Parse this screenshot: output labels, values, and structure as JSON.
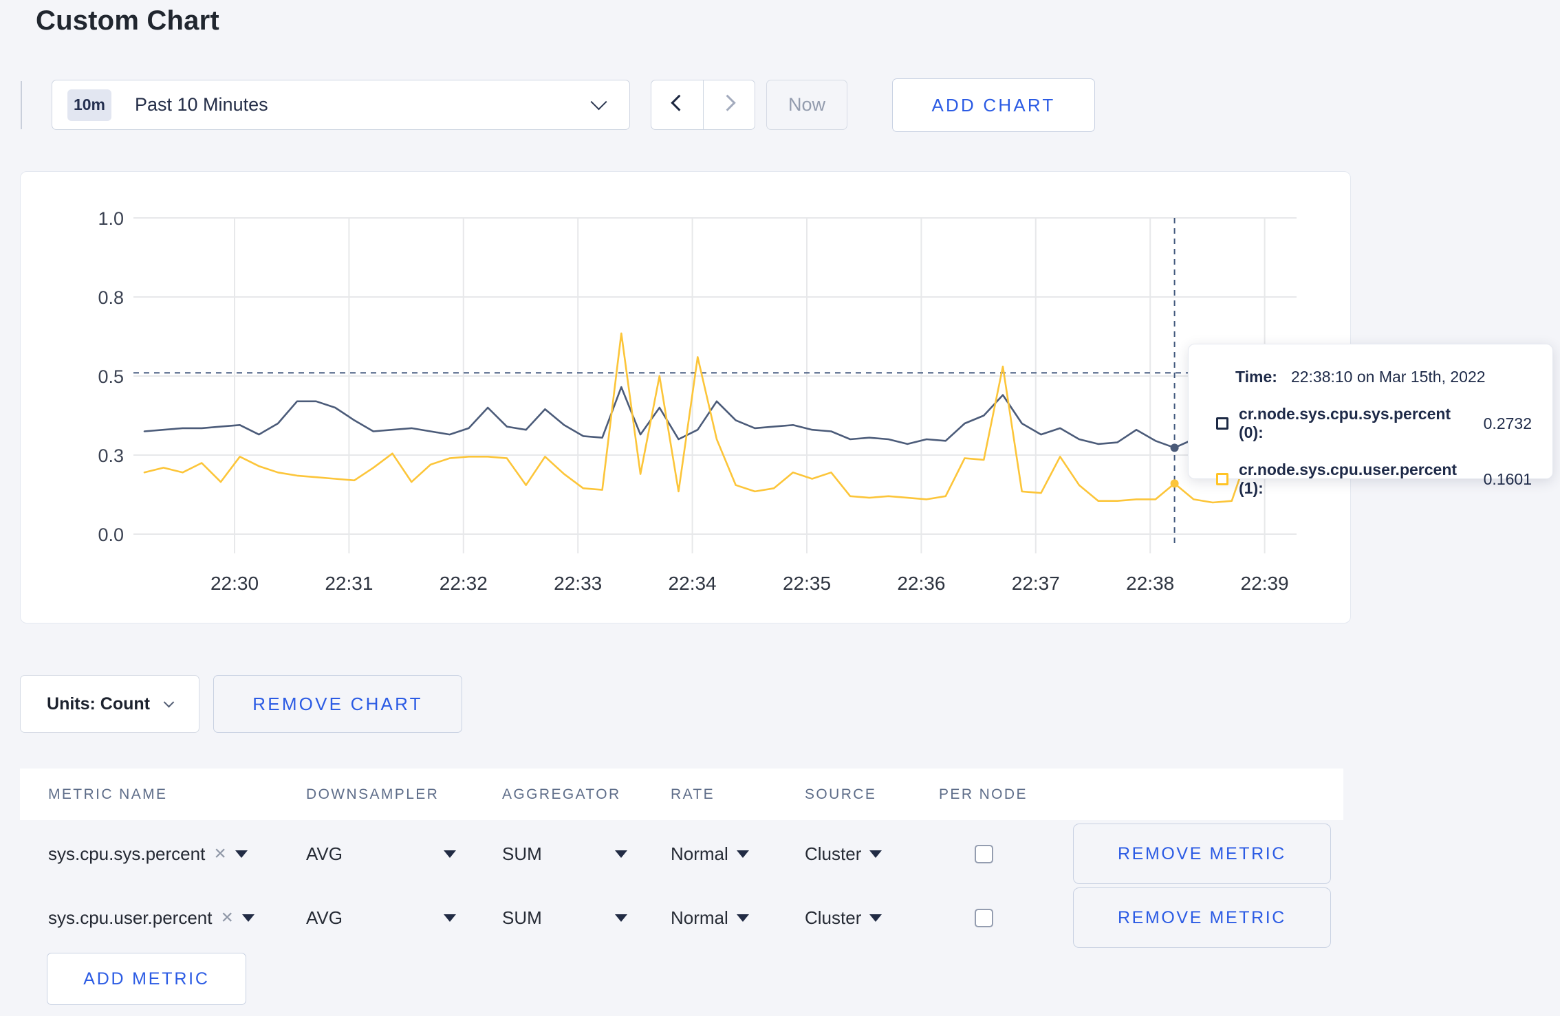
{
  "header": {
    "title": "Custom Chart"
  },
  "toolbar": {
    "time_badge": "10m",
    "time_label": "Past 10 Minutes",
    "now_label": "Now",
    "add_chart_label": "ADD CHART"
  },
  "units": {
    "label": "Units: Count",
    "remove_chart_label": "REMOVE CHART"
  },
  "colors": {
    "accent_blue": "#2b5be4",
    "series_sys": "#4b5b79",
    "series_user": "#fcc539",
    "crosshair": "#42587d",
    "grid": "#e7e8ea"
  },
  "tooltip": {
    "time_label": "Time:",
    "time_value": "22:38:10 on Mar 15th, 2022",
    "rows": [
      {
        "label": "cr.node.sys.cpu.sys.percent (0):",
        "value": "0.2732",
        "square_color": "#1c2944"
      },
      {
        "label": "cr.node.sys.cpu.user.percent (1):",
        "value": "0.1601",
        "square_color": "#ffc426"
      }
    ]
  },
  "chart_data": {
    "type": "line",
    "title": "",
    "xlabel": "",
    "ylabel": "",
    "ylim": [
      0,
      1
    ],
    "grid": true,
    "legend_position": "tooltip",
    "x_start": "22:29:10",
    "x_interval_seconds": 10,
    "x_tick_labels": [
      "22:30",
      "22:31",
      "22:32",
      "22:33",
      "22:34",
      "22:35",
      "22:36",
      "22:37",
      "22:38",
      "22:39"
    ],
    "y_tick_labels": [
      "0.0",
      "0.3",
      "0.5",
      "0.8",
      "1.0"
    ],
    "y_tick_values": [
      0,
      0.25,
      0.5,
      0.75,
      1.0
    ],
    "crosshair": {
      "time": "22:38:10",
      "index": 54,
      "hline_value": 0.51
    },
    "series": [
      {
        "name": "cr.node.sys.cpu.sys.percent",
        "color": "#4b5b79",
        "values": [
          0.325,
          0.33,
          0.335,
          0.335,
          0.34,
          0.345,
          0.315,
          0.35,
          0.42,
          0.42,
          0.4,
          0.36,
          0.325,
          0.33,
          0.335,
          0.325,
          0.315,
          0.335,
          0.4,
          0.34,
          0.33,
          0.395,
          0.345,
          0.31,
          0.305,
          0.465,
          0.315,
          0.4,
          0.3,
          0.33,
          0.42,
          0.36,
          0.335,
          0.34,
          0.345,
          0.33,
          0.325,
          0.3,
          0.305,
          0.3,
          0.285,
          0.3,
          0.295,
          0.35,
          0.375,
          0.44,
          0.35,
          0.315,
          0.335,
          0.3,
          0.285,
          0.29,
          0.33,
          0.295,
          0.2732,
          0.3,
          0.31,
          0.295,
          0.3,
          0.305,
          0.3
        ]
      },
      {
        "name": "cr.node.sys.cpu.user.percent",
        "color": "#fcc539",
        "values": [
          0.195,
          0.21,
          0.195,
          0.225,
          0.165,
          0.245,
          0.215,
          0.195,
          0.185,
          0.18,
          0.175,
          0.17,
          0.21,
          0.255,
          0.165,
          0.22,
          0.24,
          0.245,
          0.245,
          0.24,
          0.155,
          0.245,
          0.19,
          0.145,
          0.14,
          0.635,
          0.19,
          0.5,
          0.135,
          0.56,
          0.3,
          0.155,
          0.135,
          0.145,
          0.195,
          0.175,
          0.195,
          0.12,
          0.115,
          0.12,
          0.115,
          0.11,
          0.12,
          0.24,
          0.235,
          0.53,
          0.135,
          0.13,
          0.245,
          0.155,
          0.105,
          0.105,
          0.11,
          0.11,
          0.1601,
          0.11,
          0.1,
          0.105,
          0.28,
          0.22,
          0.27
        ]
      }
    ]
  },
  "metrics_table": {
    "columns": [
      "METRIC NAME",
      "DOWNSAMPLER",
      "AGGREGATOR",
      "RATE",
      "SOURCE",
      "PER NODE"
    ],
    "remove_metric_label": "REMOVE METRIC",
    "add_metric_label": "ADD METRIC",
    "rows": [
      {
        "metric": "sys.cpu.sys.percent",
        "downsampler": "AVG",
        "aggregator": "SUM",
        "rate": "Normal",
        "source": "Cluster",
        "per_node": false
      },
      {
        "metric": "sys.cpu.user.percent",
        "downsampler": "AVG",
        "aggregator": "SUM",
        "rate": "Normal",
        "source": "Cluster",
        "per_node": false
      }
    ]
  }
}
